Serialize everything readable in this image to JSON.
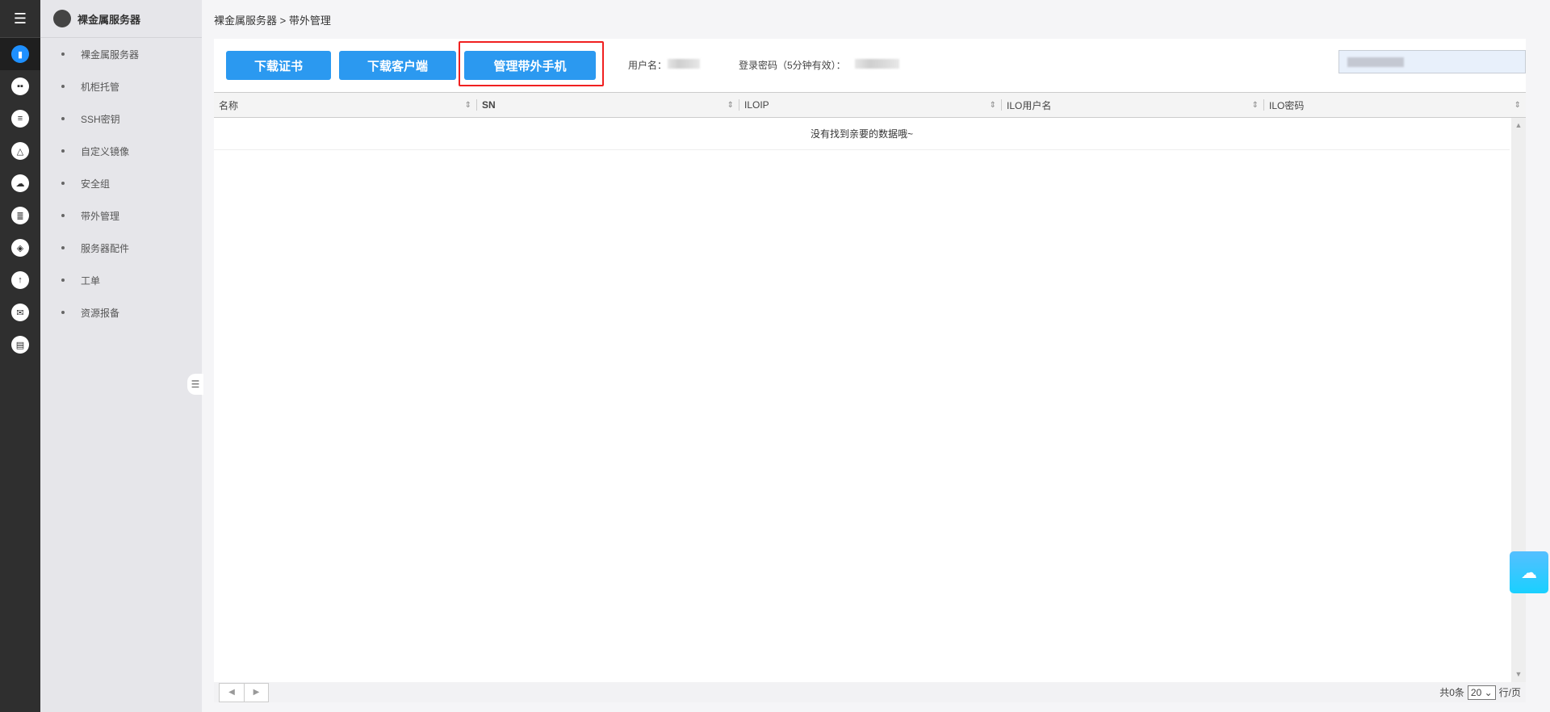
{
  "sidebar": {
    "title": "裸金属服务器",
    "items": [
      {
        "label": "裸金属服务器"
      },
      {
        "label": "机柜托管"
      },
      {
        "label": "SSH密钥"
      },
      {
        "label": "自定义镜像"
      },
      {
        "label": "安全组"
      },
      {
        "label": "带外管理"
      },
      {
        "label": "服务器配件"
      },
      {
        "label": "工单"
      },
      {
        "label": "资源报备"
      }
    ]
  },
  "icons": [
    "server-icon",
    "rack-icon",
    "key-icon",
    "image-icon",
    "security-icon",
    "database-icon",
    "layers-icon",
    "cloud-upload-icon",
    "mail-icon",
    "id-card-icon"
  ],
  "breadcrumb": "裸金属服务器 > 带外管理",
  "toolbar": {
    "download_cert": "下载证书",
    "download_client": "下载客户端",
    "manage_phone": "管理带外手机",
    "username_label": "用户名：",
    "password_label": "登录密码（5分钟有效）："
  },
  "table": {
    "columns": [
      "名称",
      "SN",
      "ILOIP",
      "ILO用户名",
      "ILO密码"
    ],
    "empty_text": "没有找到亲要的数据哦~"
  },
  "pagination": {
    "total": "共0条",
    "page_size": "20",
    "per_page_label": "行/页"
  },
  "colors": {
    "primary": "#2b99f0",
    "highlight": "#f02020"
  }
}
